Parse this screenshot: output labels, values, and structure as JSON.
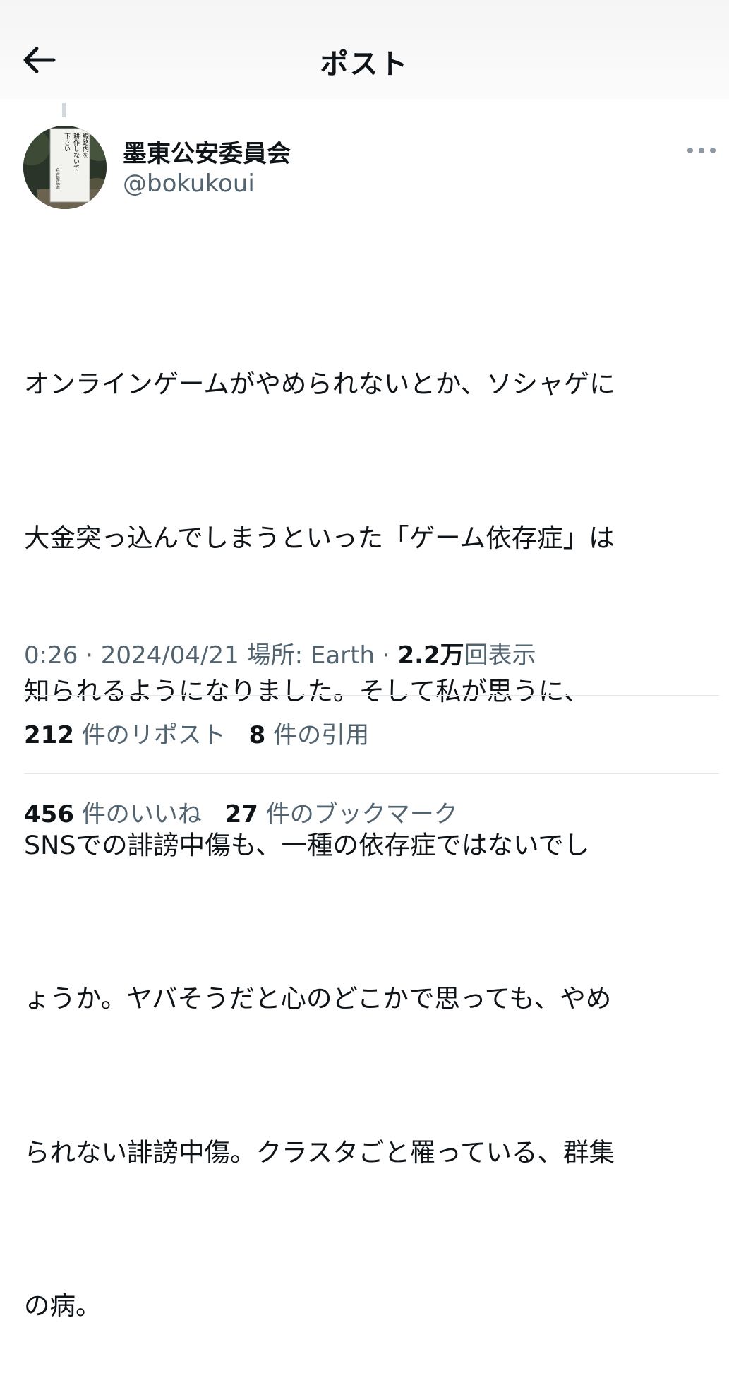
{
  "header": {
    "title": "ポスト",
    "back_icon": "arrow-left-icon"
  },
  "author": {
    "display_name": "墨東公安委員会",
    "handle": "@bokukoui",
    "avatar_sign_text": [
      "線路内を",
      "耕作しないで",
      "下さい",
      "名古屋鉄道"
    ]
  },
  "tweet": {
    "lines": [
      "オンラインゲームがやめられないとか、ソシャゲに",
      "大金突っ込んでしまうといった「ゲーム依存症」は",
      "知られるようになりました。そして私が思うに、",
      "SNSでの誹謗中傷も、一種の依存症ではないでし",
      "ょうか。ヤバそうだと心のどこかで思っても、やめ",
      "られない誹謗中傷。クラスタごと罹っている、群集",
      "の病。"
    ]
  },
  "meta": {
    "time": "0:26",
    "sep1": " · ",
    "date": "2024/04/21",
    "location": " 場所: Earth",
    "sep2": " · ",
    "views_value": "2.2万",
    "views_label": "回表示"
  },
  "stats_row1": {
    "reposts_value": "212",
    "reposts_label": "件のリポスト",
    "quotes_value": "8",
    "quotes_label": "件の引用"
  },
  "stats_row2": {
    "likes_value": "456",
    "likes_label": "件のいいね",
    "bookmarks_value": "27",
    "bookmarks_label": "件のブックマーク"
  },
  "colors": {
    "text": "#0f1419",
    "secondary": "#536471",
    "divider": "#e1e8ed"
  }
}
